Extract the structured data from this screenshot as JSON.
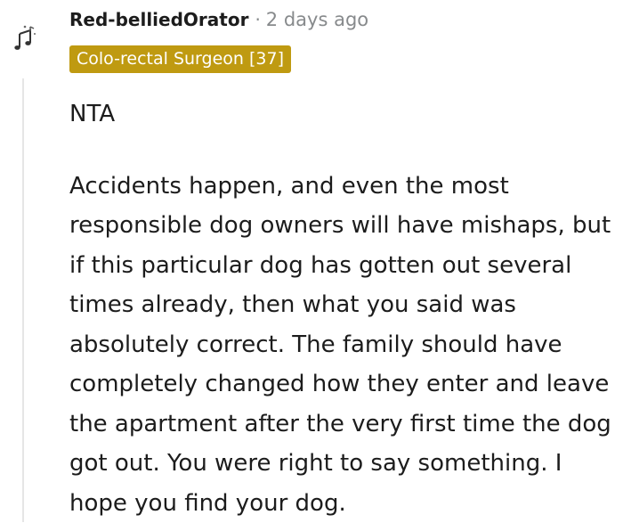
{
  "comment": {
    "author": "Red-belliedOrator",
    "separator": "·",
    "timestamp": "2 days ago",
    "flair": "Colo-rectal Surgeon [37]",
    "paragraphs": [
      "NTA",
      "Accidents happen, and even the most responsible dog owners will have mishaps, but if this particular dog has gotten out several times already, then what you said was absolutely correct. The family should have completely changed how they enter and leave the apartment after the very first time the dog got out. You were right to say something. I hope you find your dog."
    ]
  },
  "icons": {
    "avatar": "music-notes-icon"
  },
  "colors": {
    "flair_background": "#bf9a11",
    "flair_text": "#ffffff",
    "meta_text": "#878a8c",
    "thread_line": "#e6e6e6"
  }
}
